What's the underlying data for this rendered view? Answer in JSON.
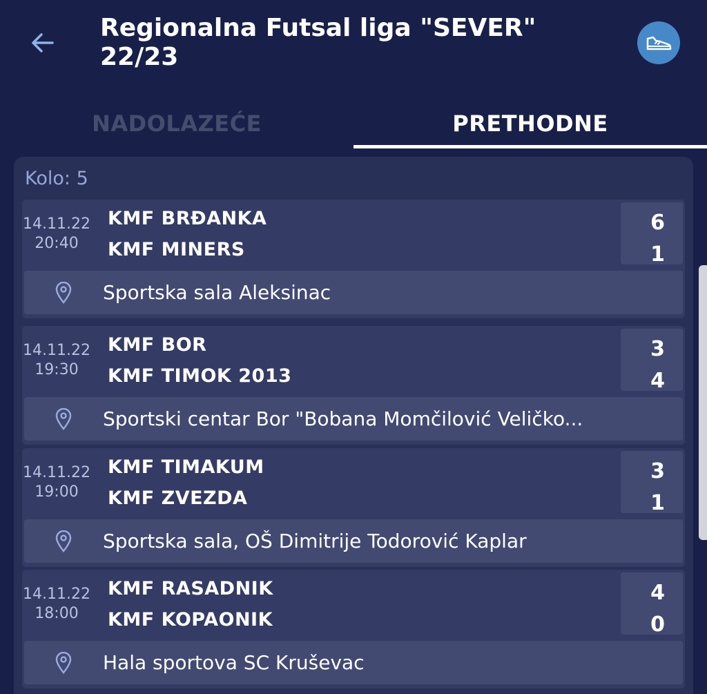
{
  "header": {
    "title": "Regionalna Futsal liga \"SEVER\" 22/23",
    "back_icon": "arrow-left-icon",
    "action_icon": "shoe-icon",
    "action_color": "#4789c8"
  },
  "tabs": [
    {
      "label": "NADOLAZEĆE",
      "active": false
    },
    {
      "label": "PRETHODNE",
      "active": true
    }
  ],
  "round": {
    "label": "Kolo: 5"
  },
  "matches": [
    {
      "date": "14.11.22",
      "time": "20:40",
      "home": "KMF BRĐANKA",
      "away": "KMF MINERS",
      "home_score": "6",
      "away_score": "1",
      "venue": "Sportska sala Aleksinac"
    },
    {
      "date": "14.11.22",
      "time": "19:30",
      "home": "KMF BOR",
      "away": "KMF TIMOK 2013",
      "home_score": "3",
      "away_score": "4",
      "venue": "Sportski centar Bor \"Bobana Momčilović Veličko..."
    },
    {
      "date": "14.11.22",
      "time": "19:00",
      "home": "KMF TIMAKUM",
      "away": "KMF ZVEZDA",
      "home_score": "3",
      "away_score": "1",
      "venue": "Sportska sala, OŠ Dimitrije Todorović Kaplar"
    },
    {
      "date": "14.11.22",
      "time": "18:00",
      "home": "KMF RASADNIK",
      "away": "KMF KOPAONIK",
      "home_score": "4",
      "away_score": "0",
      "venue": "Hala sportova SC Kruševac"
    }
  ],
  "colors": {
    "background": "#182049",
    "panel": "#283057",
    "card": "#343b64",
    "inner": "#424a72",
    "muted_text": "#98a5d8"
  }
}
